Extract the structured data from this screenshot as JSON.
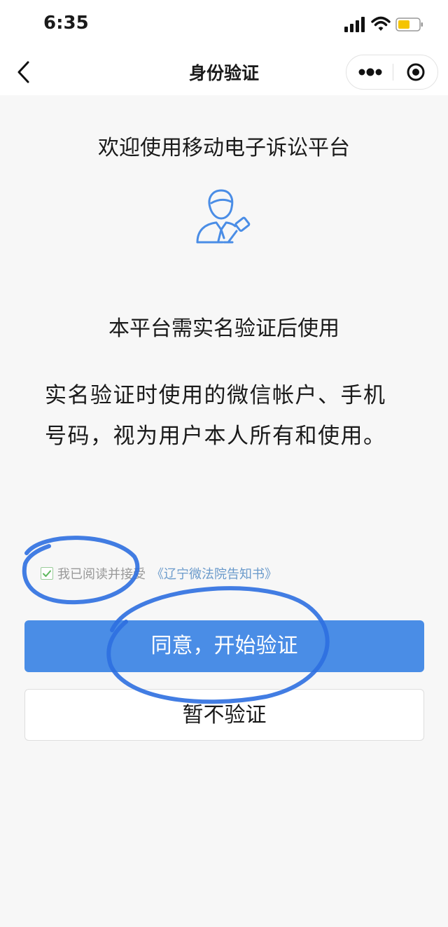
{
  "status_bar": {
    "time": "6:35"
  },
  "nav": {
    "title": "身份验证",
    "icons": [
      "back-icon",
      "more-icon",
      "close-target-icon"
    ]
  },
  "content": {
    "welcome": "欢迎使用移动电子诉讼平台",
    "requirement": "本平台需实名验证后使用",
    "notice": "实名验证时使用的微信帐户、手机号码，视为用户本人所有和使用。"
  },
  "agreement": {
    "checked": true,
    "text": "我已阅读并接受",
    "link": "《辽宁微法院告知书》"
  },
  "buttons": {
    "agree": "同意，开始验证",
    "skip": "暂不验证"
  },
  "colors": {
    "accent": "#4a8de6",
    "link": "#6a9acb",
    "annotation": "#2e6fe0"
  }
}
